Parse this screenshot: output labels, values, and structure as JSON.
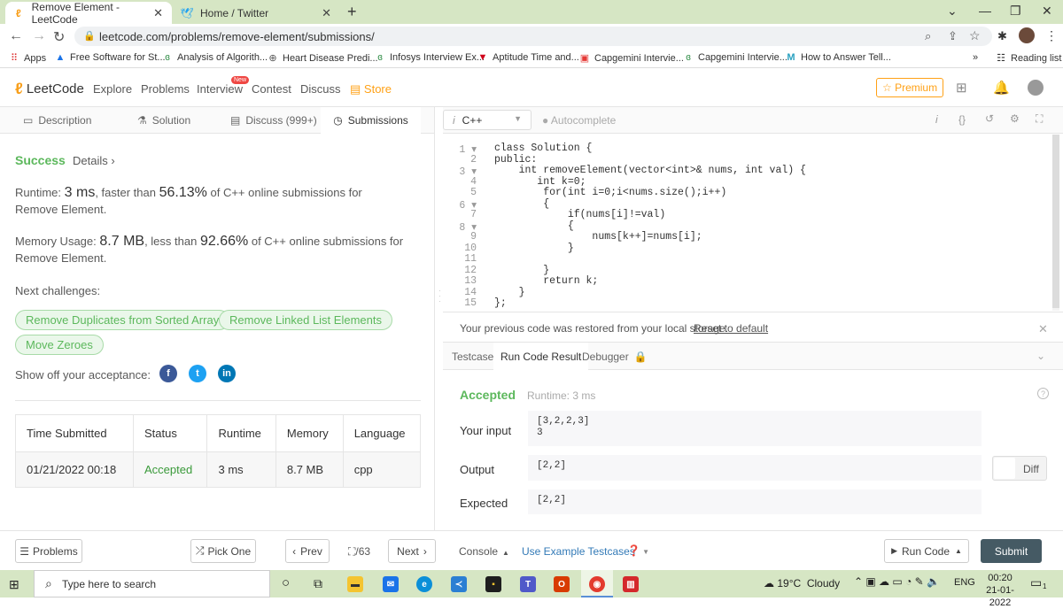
{
  "browser": {
    "tabs": [
      {
        "title": "Remove Element - LeetCode",
        "icon": "leetcode-icon",
        "active": true
      },
      {
        "title": "Home / Twitter",
        "icon": "twitter-icon",
        "active": false
      }
    ],
    "new_tab": "+",
    "url": "leetcode.com/problems/remove-element/submissions/",
    "bookmarks": [
      {
        "label": "Apps",
        "icon": "apps-grid-icon"
      },
      {
        "label": "Free Software for St...",
        "icon": "drive-icon"
      },
      {
        "label": "Analysis of Algorith...",
        "icon": "gfg-icon"
      },
      {
        "label": "Heart Disease Predi...",
        "icon": "globe-icon"
      },
      {
        "label": "Infosys Interview Ex...",
        "icon": "gfg-icon"
      },
      {
        "label": "Aptitude Time and...",
        "icon": "indiabix-icon"
      },
      {
        "label": "Capgemini Intervie...",
        "icon": "prepinsta-icon"
      },
      {
        "label": "Capgemini Intervie...",
        "icon": "gfg-icon"
      },
      {
        "label": "How to Answer Tell...",
        "icon": "m-icon"
      }
    ],
    "more_bookmarks": "»",
    "reading_list": "Reading list"
  },
  "lc_nav": {
    "logo": "LeetCode",
    "links": [
      "Explore",
      "Problems",
      "Interview",
      "Contest",
      "Discuss"
    ],
    "new_badge": "New",
    "store": "Store",
    "premium": "Premium"
  },
  "left_tabs": [
    {
      "label": "Description",
      "icon": "description-icon"
    },
    {
      "label": "Solution",
      "icon": "flask-icon"
    },
    {
      "label": "Discuss (999+)",
      "icon": "discuss-icon"
    },
    {
      "label": "Submissions",
      "icon": "clock-icon"
    }
  ],
  "result": {
    "status": "Success",
    "details": "Details",
    "runtime_prefix": "Runtime:",
    "runtime_value": "3 ms",
    "runtime_mid": ", faster than",
    "runtime_pct": "56.13%",
    "runtime_suffix": "of C++ online submissions for Remove Element.",
    "memory_prefix": "Memory Usage:",
    "memory_value": "8.7 MB",
    "memory_mid": ", less than",
    "memory_pct": "92.66%",
    "memory_suffix": "of C++ online submissions for Remove Element.",
    "next_challenges": "Next challenges:",
    "challenges": [
      "Remove Duplicates from Sorted Array",
      "Remove Linked List Elements",
      "Move Zeroes"
    ],
    "show_off": "Show off your acceptance:"
  },
  "submissions_table": {
    "headers": [
      "Time Submitted",
      "Status",
      "Runtime",
      "Memory",
      "Language"
    ],
    "rows": [
      [
        "01/21/2022 00:18",
        "Accepted",
        "3 ms",
        "8.7 MB",
        "cpp"
      ]
    ]
  },
  "editor": {
    "language": "C++",
    "autocomplete": "Autocomplete",
    "lines": [
      "class Solution {",
      "public:",
      "    int removeElement(vector<int>& nums, int val) {",
      "       int k=0;",
      "        for(int i=0;i<nums.size();i++)",
      "        {",
      "            if(nums[i]!=val)",
      "            {",
      "                nums[k++]=nums[i];",
      "            }",
      "",
      "        }",
      "        return k;",
      "    }",
      "};"
    ]
  },
  "restore_msg": "Your previous code was restored from your local storage.",
  "reset_link": "Reset to default",
  "console_tabs": [
    "Testcase",
    "Run Code Result",
    "Debugger"
  ],
  "run_result": {
    "status": "Accepted",
    "runtime": "Runtime: 3 ms",
    "input_label": "Your input",
    "input_lines": [
      "[3,2,2,3]",
      "3"
    ],
    "output_label": "Output",
    "output": "[2,2]",
    "diff": "Diff",
    "expected_label": "Expected",
    "expected": "[2,2]"
  },
  "footer": {
    "problems": "Problems",
    "pick_one": "Pick One",
    "prev": "Prev",
    "page": "/63",
    "next": "Next",
    "console": "Console",
    "use_example": "Use Example Testcases",
    "run_code": "Run Code",
    "submit": "Submit"
  },
  "taskbar": {
    "search_placeholder": "Type here to search",
    "weather": "19°C  Cloudy",
    "lang": "ENG",
    "time": "00:20",
    "date": "21-01-2022",
    "notif_count": "1"
  },
  "colors": {
    "success_green": "#5cb85c",
    "submit_bg": "#455a64",
    "premium_orange": "#ffa116",
    "chrome_green": "#d6e6c4"
  }
}
